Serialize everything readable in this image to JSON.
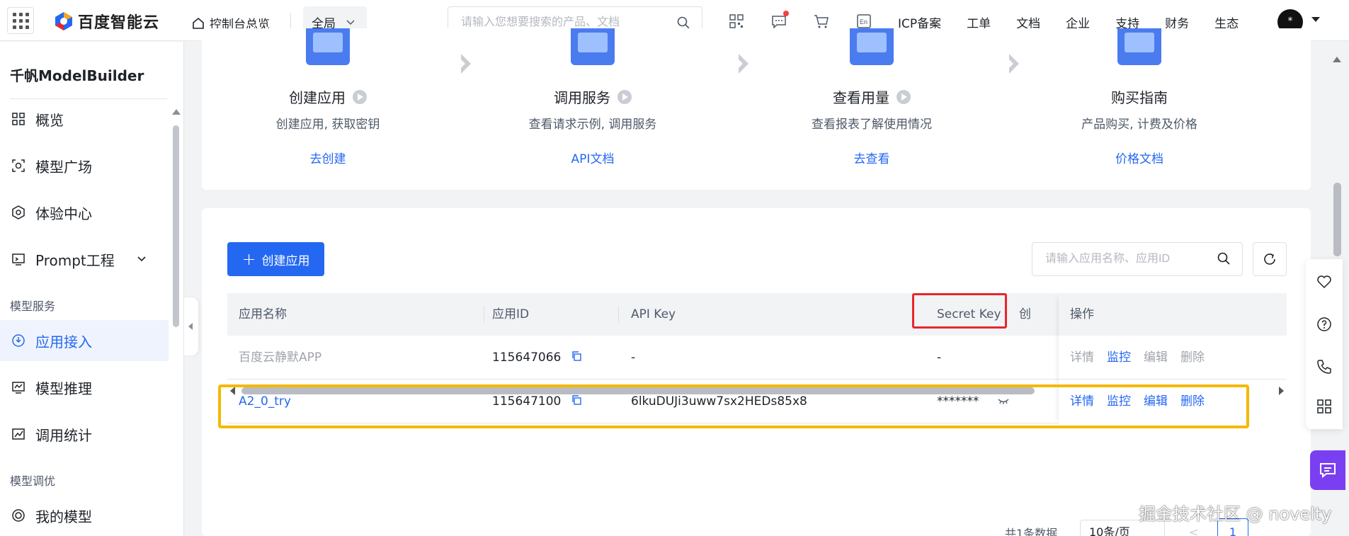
{
  "topbar": {
    "logo_text": "百度智能云",
    "console_label": "控制台总览",
    "scope_label": "全局",
    "search_placeholder": "请输入您想要搜索的产品、文档",
    "nav": [
      "ICP备案",
      "工单",
      "文档",
      "企业",
      "支持",
      "财务",
      "生态"
    ],
    "avatar_text": "*",
    "icons": [
      "qrcode-icon",
      "message-icon",
      "cart-icon",
      "language-icon"
    ]
  },
  "sidebar": {
    "title": "千帆ModelBuilder",
    "items": [
      {
        "label": "概览",
        "icon": "grid-icon"
      },
      {
        "label": "模型广场",
        "icon": "model-square-icon"
      },
      {
        "label": "体验中心",
        "icon": "experience-icon"
      },
      {
        "label": "Prompt工程",
        "icon": "prompt-icon"
      }
    ],
    "group_service": "模型服务",
    "service_items": [
      {
        "label": "应用接入",
        "icon": "app-access-icon",
        "active": true
      },
      {
        "label": "模型推理",
        "icon": "inference-icon"
      },
      {
        "label": "调用统计",
        "icon": "stats-icon"
      }
    ],
    "group_tuning": "模型调优",
    "tuning_items": [
      {
        "label": "我的模型",
        "icon": "my-model-icon"
      }
    ]
  },
  "steps": [
    {
      "title": "创建应用",
      "desc": "创建应用, 获取密钥",
      "link": "去创建"
    },
    {
      "title": "调用服务",
      "desc": "查看请求示例, 调用服务",
      "link": "API文档"
    },
    {
      "title": "查看用量",
      "desc": "查看报表了解使用情况",
      "link": "去查看"
    },
    {
      "title": "购买指南",
      "desc": "产品购买, 计费及价格",
      "link": "价格文档"
    }
  ],
  "toolbar": {
    "create_label": "创建应用",
    "search_placeholder": "请输入应用名称、应用ID"
  },
  "table": {
    "headers": {
      "name": "应用名称",
      "id": "应用ID",
      "api_key": "API Key",
      "secret_key": "Secret Key",
      "created_partial": "创",
      "ops": "操作"
    },
    "rows": [
      {
        "name": "百度云静默APP",
        "id": "115647066",
        "api_key": "-",
        "secret_key": "-",
        "ops": [
          "详情",
          "监控",
          "编辑",
          "删除"
        ]
      },
      {
        "name": "A2_0_try",
        "id": "115647100",
        "api_key": "6lkuDUJi3uww7sx2HEDs85x8",
        "secret_key": "*******",
        "ops": [
          "详情",
          "监控",
          "编辑",
          "删除"
        ]
      }
    ]
  },
  "pager": {
    "total_text": "共1条数据",
    "size_text": "10条/页",
    "prev": "<",
    "page": "1"
  },
  "watermark": "掘金技术社区 @ novelty",
  "colors": {
    "primary": "#2468f2",
    "highlight_red": "#e8262c",
    "highlight_yellow": "#f5b800",
    "chat_purple": "#7b3ff2"
  }
}
